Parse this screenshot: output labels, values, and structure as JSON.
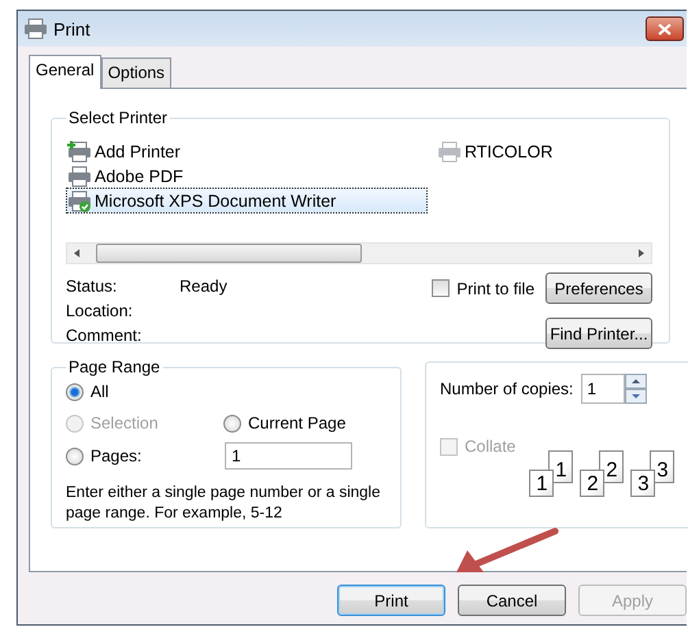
{
  "window": {
    "title": "Print"
  },
  "tabs": [
    {
      "label": "General",
      "selected": true
    },
    {
      "label": "Options",
      "selected": false
    }
  ],
  "select_printer": {
    "title": "Select Printer",
    "printers": [
      {
        "label": "Add Printer",
        "kind": "add",
        "selected": false,
        "default": false,
        "offline": false
      },
      {
        "label": "Adobe PDF",
        "kind": "printer",
        "selected": false,
        "default": false,
        "offline": false
      },
      {
        "label": "Microsoft XPS Document Writer",
        "kind": "printer",
        "selected": true,
        "default": true,
        "offline": false
      },
      {
        "label": "RTICOLOR",
        "kind": "printer",
        "selected": false,
        "default": false,
        "offline": true
      }
    ],
    "info": [
      {
        "label": "Status:",
        "value": "Ready"
      },
      {
        "label": "Location:"
      },
      {
        "label": "Comment:"
      }
    ],
    "print_to_file": {
      "label": "Print to file",
      "checked": false
    },
    "preferences_button": "Preferences",
    "find_printer_button": "Find Printer..."
  },
  "page_range": {
    "title": "Page Range",
    "options": [
      {
        "label": "All",
        "selected": true,
        "disabled": false
      },
      {
        "label": "Selection",
        "selected": false,
        "disabled": true
      },
      {
        "label": "Current Page",
        "selected": false,
        "disabled": false
      },
      {
        "label": "Pages:",
        "selected": false,
        "disabled": false
      }
    ],
    "pages_value": "1",
    "hint": "Enter either a single page number or a single page range.  For example, 5-12"
  },
  "copies": {
    "label": "Number of copies:",
    "value": "1",
    "collate": {
      "label": "Collate",
      "checked": false,
      "disabled": true
    },
    "collate_pages": [
      {
        "back": "1",
        "front": "1"
      },
      {
        "back": "2",
        "front": "2"
      },
      {
        "back": "3",
        "front": "3"
      }
    ]
  },
  "buttons": [
    {
      "label": "Print",
      "default": true,
      "disabled": false
    },
    {
      "label": "Cancel",
      "default": false,
      "disabled": false
    },
    {
      "label": "Apply",
      "default": false,
      "disabled": true
    }
  ],
  "annotations": [
    {
      "kind": "arrow"
    }
  ]
}
